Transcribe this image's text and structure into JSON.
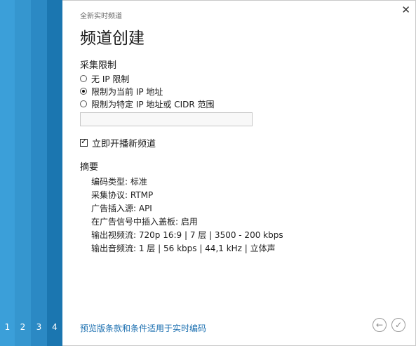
{
  "wizard": {
    "steps": [
      "1",
      "2",
      "3",
      "4"
    ],
    "current_step": 4
  },
  "header": {
    "subtitle": "全新实时频道",
    "title": "频道创建"
  },
  "ingest_restriction": {
    "label": "采集限制",
    "options": [
      {
        "label": "无 IP 限制",
        "selected": false
      },
      {
        "label": "限制为当前 IP 地址",
        "selected": true
      },
      {
        "label": "限制为特定 IP 地址或 CIDR 范围",
        "selected": false
      }
    ],
    "cidr_value": ""
  },
  "start_broadcast": {
    "label": "立即开播新频道",
    "checked": true
  },
  "summary": {
    "title": "摘要",
    "lines": [
      "编码类型: 标准",
      "采集协议: RTMP",
      "广告插入源: API",
      "在广告信号中插入盖板: 启用",
      "输出视频流: 720p 16:9 | 7 层 | 3500 - 200 kbps",
      "输出音频流: 1 层 | 56 kbps | 44,1 kHz | 立体声"
    ]
  },
  "footer": {
    "terms_link": "预览版条款和条件适用于实时编码"
  },
  "icons": {
    "close": "close-icon",
    "back": "arrow-left-icon",
    "done": "checkmark-icon"
  },
  "colors": {
    "link": "#1b6fb0",
    "step_bar": [
      "#3b9fd9",
      "#3596cf",
      "#2b89c4",
      "#1b76b0"
    ]
  }
}
